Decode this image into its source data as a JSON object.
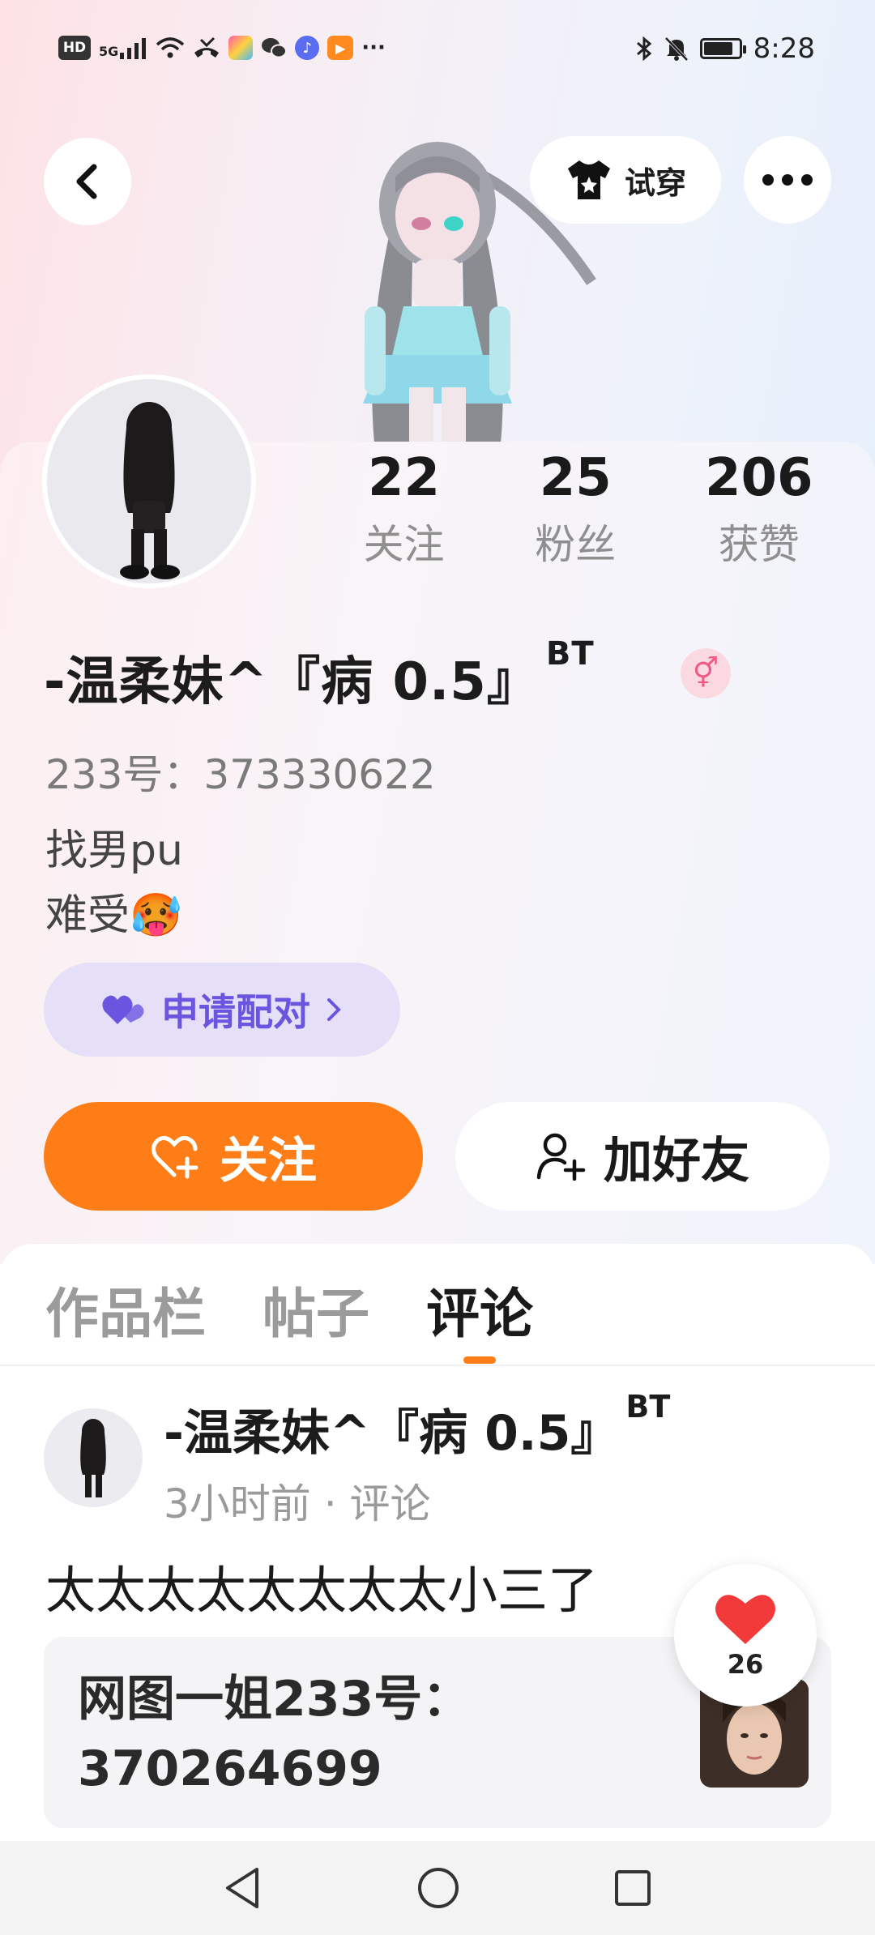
{
  "status_bar": {
    "left_icons": [
      "hd-icon",
      "5g-signal-icon",
      "wifi-icon",
      "missed-call-icon",
      "app-notification-icon",
      "wechat-icon",
      "music-icon",
      "video-icon",
      "more-notifications-icon"
    ],
    "hd_label": "HD",
    "network_label": "5G",
    "more_label": "···",
    "time": "8:28",
    "battery_level": 0.85
  },
  "top_bar": {
    "tryon_label": "试穿"
  },
  "profile": {
    "stats": [
      {
        "value": "22",
        "label": "关注"
      },
      {
        "value": "25",
        "label": "粉丝"
      },
      {
        "value": "206",
        "label": "获赞"
      }
    ],
    "username": "-温柔妹^『病 0.5』",
    "username_sup": "BT",
    "gender": "female",
    "gender_symbol": "⚥",
    "user_id": "233号：373330622",
    "bio_lines": [
      "找男pu",
      "难受🥵"
    ],
    "match_label": "申请配对",
    "follow_label": "关注",
    "add_friend_label": "加好友"
  },
  "tabs": [
    {
      "label": "作品栏",
      "active": false
    },
    {
      "label": "帖子",
      "active": false
    },
    {
      "label": "评论",
      "active": true
    }
  ],
  "comment": {
    "author": "-温柔妹^『病 0.5』",
    "author_sup": "BT",
    "meta": "3小时前 · 评论",
    "text": "太太太太太太太太小三了",
    "quote_text": "网图一姐233号：370264699",
    "like_count": "26"
  },
  "colors": {
    "accent_orange": "#ff7d16",
    "match_purple": "#6b55e0",
    "match_bg": "#e5e0f7",
    "like_red": "#f23a3a"
  }
}
